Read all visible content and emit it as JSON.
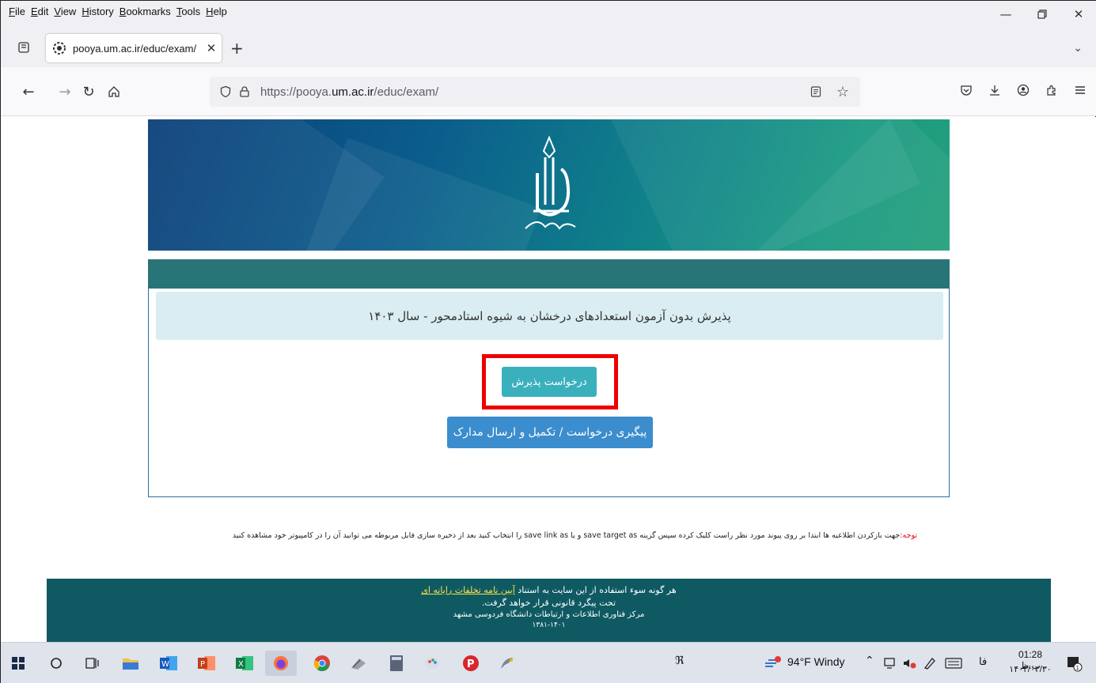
{
  "menu": [
    "File",
    "Edit",
    "View",
    "History",
    "Bookmarks",
    "Tools",
    "Help"
  ],
  "tab": {
    "title": "pooya.um.ac.ir/educ/exam/"
  },
  "url": {
    "prefix": "https://pooya.",
    "domain": "um.ac.ir",
    "path": "/educ/exam/"
  },
  "page": {
    "banner_logo_alt": "دانشگاه فردوسی مشهد",
    "info_title": "پذیرش بدون آزمون استعدادهای درخشان به شیوه استادمحور - سال ۱۴۰۳",
    "apply_button": "درخواست پذیرش",
    "track_button": "پیگیری درخواست / تکمیل و ارسال مدارک",
    "notice_label": "توجه:",
    "notice_text": "جهت بازکردن اطلاعیه ها ابتدا بر روی پیوند مورد نظر راست کلیک کرده سپس گزینه save target as و یا save link as را انتخاب کنید بعد از ذخیره سازی فایل مربوطه می توانید آن را در کامپیوتر خود مشاهده کنید"
  },
  "footer": {
    "line1_prefix": "هر گونه سوء استفاده از این سایت به استناد ",
    "line1_link": "آیین نامه تخلفات رایانه ای",
    "line2": "تحت پیگرد قانونی قرار خواهد گرفت.",
    "line3": "مرکز فناوری اطلاعات و ارتباطات دانشگاه فردوسی مشهد",
    "line4": "۱۳۸۱-۱۴۰۱"
  },
  "taskbar": {
    "weather": "94°F Windy",
    "lang": "فا",
    "time": "01:28 ب.ظ",
    "date": "۱۴۰۳/۰۳/۳۰",
    "notif_count": "1"
  },
  "colors": {
    "header_bar": "#297477",
    "info_bg": "#d9edf2",
    "apply_btn": "#3bb0bd",
    "track_btn": "#3b8dcd",
    "highlight": "#ef0000",
    "footer_bg": "#0f5a62"
  }
}
